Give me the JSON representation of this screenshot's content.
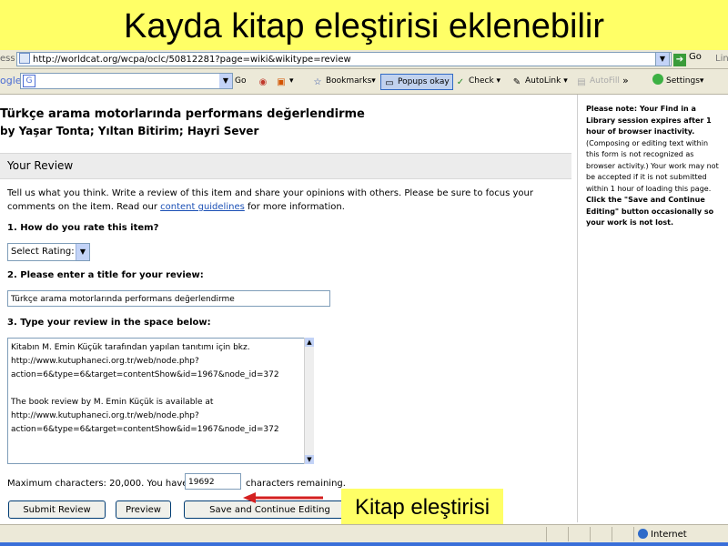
{
  "slide": {
    "title": "Kayda kitap eleştirisi eklenebilir",
    "callout": "Kitap eleştirisi"
  },
  "browser": {
    "address_label": "ess",
    "url": "http://worldcat.org/wcpa/oclc/50812281?page=wiki&wikitype=review",
    "go_label": "Go",
    "links_label": "Lin",
    "toolbar": {
      "google_logo": "ogle",
      "google_go": "Go",
      "bookmarks": "Bookmarks▾",
      "popups": "Popups okay",
      "check": "Check",
      "autolink": "AutoLink",
      "autofill": "AutoFill",
      "more": "»",
      "settings": "Settings▾"
    },
    "status": {
      "zone": "Internet"
    }
  },
  "page": {
    "book_title": "Türkçe arama motorlarında performans değerlendirme",
    "authors": "by Yaşar Tonta; Yıltan Bitirim; Hayri Sever",
    "review_header": "Your Review",
    "intro_before_link": "Tell us what you think. Write a review of this item and share your opinions with others. Please be sure to focus your comments on the item. Read our ",
    "intro_link": "content guidelines",
    "intro_after_link": " for more information.",
    "q1": "1. How do you rate this item?",
    "rating_select": "Select Rating:",
    "q2": "2. Please enter a title for your review:",
    "review_title_value": "Türkçe arama motorlarında performans değerlendirme",
    "q3": "3. Type your review in the space below:",
    "review_text": {
      "line1": "Kitabın M. Emin Küçük tarafından yapılan tanıtımı için bkz.",
      "line2": "http://www.kutuphaneci.org.tr/web/node.php?",
      "line3": "action=6&type=6&target=contentShow&id=1967&node_id=372",
      "line5": "The book review by M. Emin Küçük is available at",
      "line6": "http://www.kutuphaneci.org.tr/web/node.php?",
      "line7": "action=6&type=6&target=contentShow&id=1967&node_id=372"
    },
    "max_chars_text": "Maximum characters: 20,000. You have",
    "chars_remaining_value": "19692",
    "chars_remaining_suffix": "characters remaining.",
    "buttons": {
      "submit": "Submit Review",
      "preview": "Preview",
      "save_continue": "Save and Continue Editing"
    }
  },
  "side_note": {
    "bold1": "Please note: Your Find in a Library session expires after 1 hour of browser inactivity.",
    "normal": "(Composing or editing text within this form is not recognized as browser activity.) Your work may not be accepted if it is not submitted within 1 hour of loading this page.",
    "bold2": "Click the \"Save and Continue Editing\" button occasionally so your work is not lost."
  },
  "colors": {
    "slide_highlight": "#ffff66",
    "arrow": "#d42020",
    "link": "#1a4fb5",
    "chrome": "#ece9d8"
  }
}
